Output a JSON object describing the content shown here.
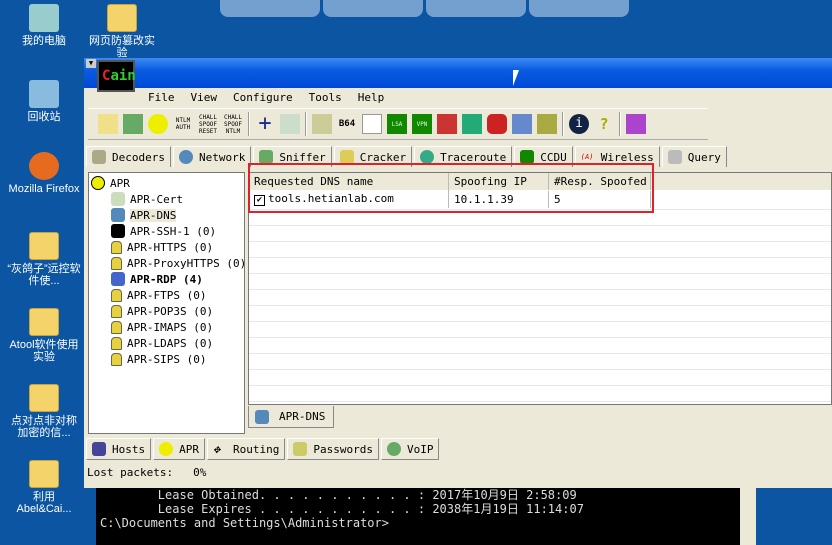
{
  "desktop": {
    "icons": [
      "我的电脑",
      "网页防篡改实验",
      "回收站",
      "Mozilla Firefox",
      "“灰鸽子”远控软件使...",
      "Atool软件使用实验",
      "点对点非对称加密的信...",
      "利用 Abel&Cai..."
    ]
  },
  "app": {
    "logo": "Cain",
    "logo_text": [
      "C",
      "ain"
    ]
  },
  "menu": [
    "File",
    "View",
    "Configure",
    "Tools",
    "Help"
  ],
  "toolbar": {
    "icons": [
      "open-icon",
      "sniffer-icon",
      "apr-icon",
      "ntlm-auth-icon",
      "chall-spoof-reset-icon",
      "chall-spoof-ntlm-icon",
      "add-icon",
      "recycle-icon",
      "certificate-icon",
      "base64-icon",
      "key-icon",
      "lsa-icon",
      "vpn-icon",
      "rdp-icon",
      "hash-icon",
      "cisco-icon",
      "network-icon",
      "password-icon",
      "info-icon",
      "help-icon",
      "exit-icon"
    ],
    "labels": {
      "ntlm": "NTLM AUTH",
      "reset": "CHALL SPOOF RESET",
      "ntlm2": "CHALL SPOOF NTLM",
      "b64": "B64",
      "lsa": "LSA",
      "vpn": "VPN"
    }
  },
  "tabs": [
    "Decoders",
    "Network",
    "Sniffer",
    "Cracker",
    "Traceroute",
    "CCDU",
    "Wireless",
    "Query"
  ],
  "tree": {
    "root": "APR",
    "items": [
      {
        "label": "APR-Cert",
        "bold": false
      },
      {
        "label": "APR-DNS",
        "bold": false
      },
      {
        "label": "APR-SSH-1  (0)",
        "bold": false
      },
      {
        "label": "APR-HTTPS  (0)",
        "bold": false
      },
      {
        "label": "APR-ProxyHTTPS  (0)",
        "bold": false
      },
      {
        "label": "APR-RDP  (4)",
        "bold": true
      },
      {
        "label": "APR-FTPS  (0)",
        "bold": false
      },
      {
        "label": "APR-POP3S  (0)",
        "bold": false
      },
      {
        "label": "APR-IMAPS  (0)",
        "bold": false
      },
      {
        "label": "APR-LDAPS  (0)",
        "bold": false
      },
      {
        "label": "APR-SIPS  (0)",
        "bold": false
      }
    ]
  },
  "table": {
    "columns": [
      "Requested DNS name",
      "Spoofing IP",
      "#Resp. Spoofed"
    ],
    "rows": [
      {
        "checked": true,
        "name": "tools.hetianlab.com",
        "ip": "10.1.1.39",
        "count": "5"
      }
    ]
  },
  "subtab": "APR-DNS",
  "bottom_tabs": [
    "Hosts",
    "APR",
    "Routing",
    "Passwords",
    "VoIP"
  ],
  "status": {
    "label": "Lost packets:",
    "value": "0%"
  },
  "console": {
    "lines": [
      "        Lease Obtained. . . . . . . . . . . : 2017年10月9日 2:58:09",
      "        Lease Expires . . . . . . . . . . . : 2038年1月19日 11:14:07",
      "",
      "C:\\Documents and Settings\\Administrator>"
    ]
  },
  "colors": {
    "highlight": "#e0202a",
    "titlebar": "#0a5ce0"
  }
}
